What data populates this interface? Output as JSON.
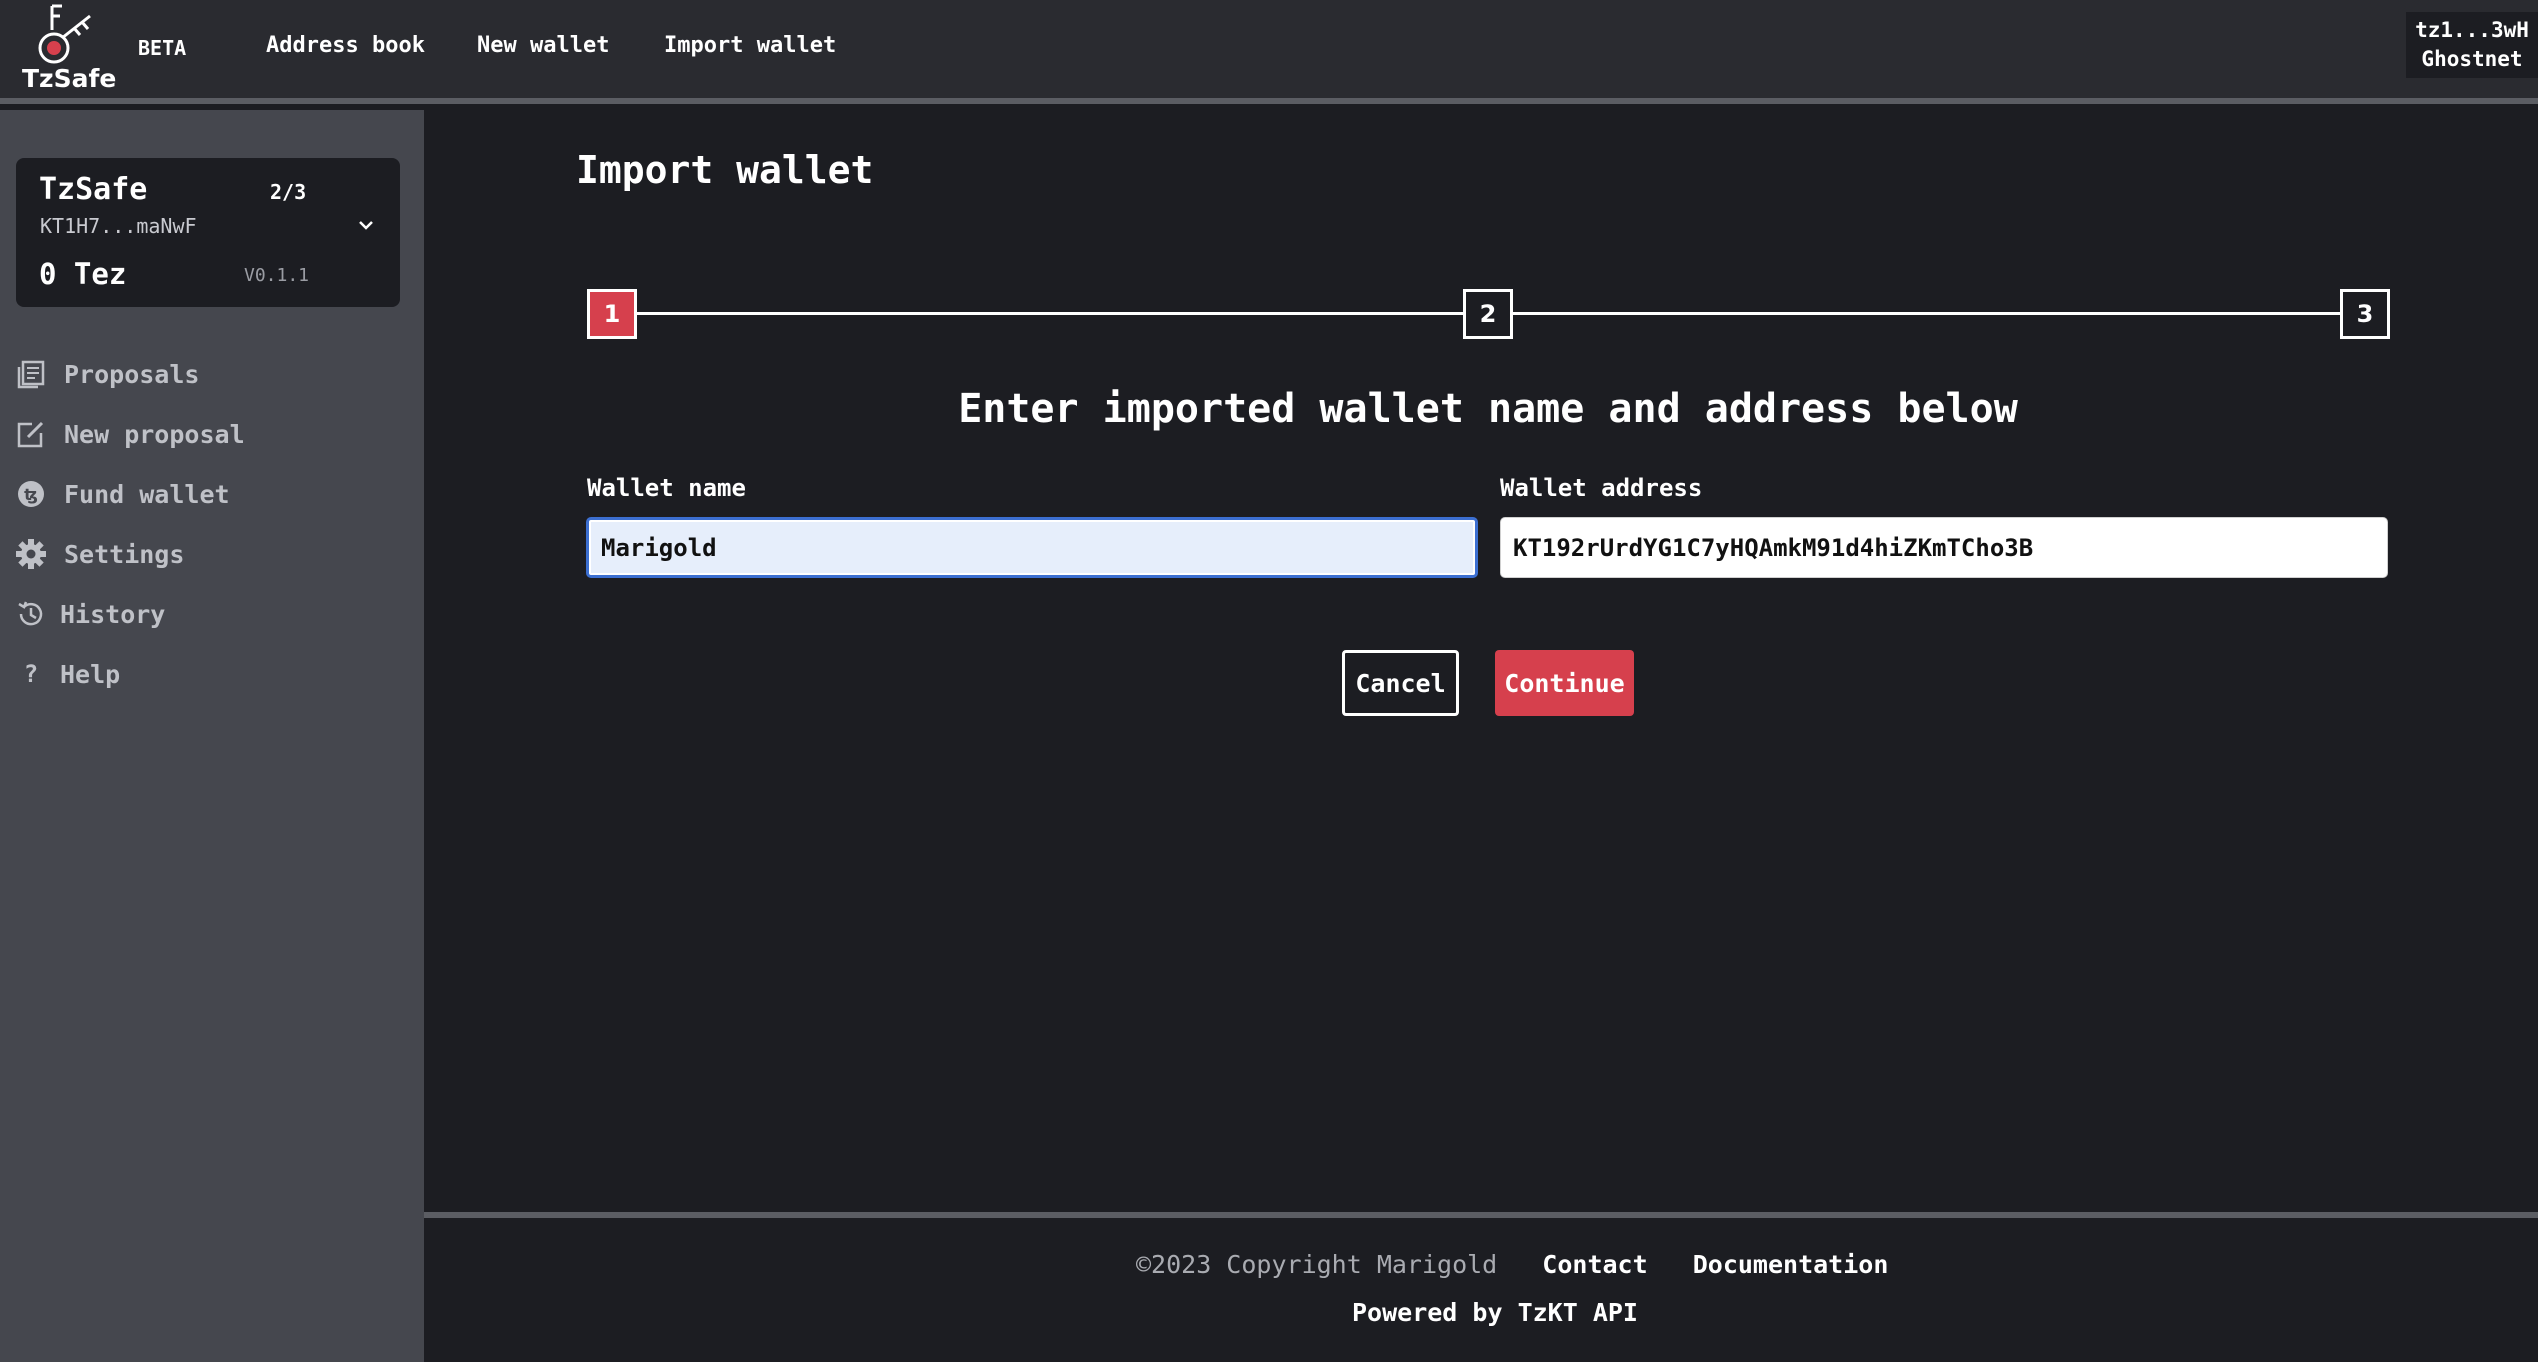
{
  "header": {
    "logo_text": "TzSafe",
    "beta_label": "BETA",
    "nav": [
      "Address book",
      "New wallet",
      "Import wallet"
    ],
    "account": {
      "address": "tz1...3wH",
      "network": "Ghostnet"
    }
  },
  "sidebar": {
    "wallet": {
      "name": "TzSafe",
      "threshold": "2/3",
      "address": "KT1H7...maNwF",
      "balance": "0 Tez",
      "version": "V0.1.1"
    },
    "items": [
      {
        "label": "Proposals",
        "icon": "proposals-icon"
      },
      {
        "label": "New proposal",
        "icon": "edit-icon"
      },
      {
        "label": "Fund wallet",
        "icon": "tezos-coin-icon"
      },
      {
        "label": "Settings",
        "icon": "gear-icon"
      },
      {
        "label": "History",
        "icon": "history-icon"
      },
      {
        "label": "Help",
        "icon": "help-icon"
      }
    ]
  },
  "main": {
    "title": "Import wallet",
    "steps": [
      "1",
      "2",
      "3"
    ],
    "active_step": 1,
    "heading": "Enter imported wallet name and address below",
    "wallet_name_label": "Wallet name",
    "wallet_name_value": "Marigold",
    "wallet_address_label": "Wallet address",
    "wallet_address_value": "KT192rUrdYG1C7yHQAmkM91d4hiZKmTCho3B",
    "cancel_label": "Cancel",
    "continue_label": "Continue"
  },
  "footer": {
    "copyright": "©2023 Copyright Marigold",
    "contact": "Contact",
    "documentation": "Documentation",
    "powered_by": "Powered by TzKT API"
  },
  "colors": {
    "accent": "#d6404d",
    "background": "#1c1d22",
    "topbar": "#2a2b30",
    "sidebar": "#45474e"
  }
}
